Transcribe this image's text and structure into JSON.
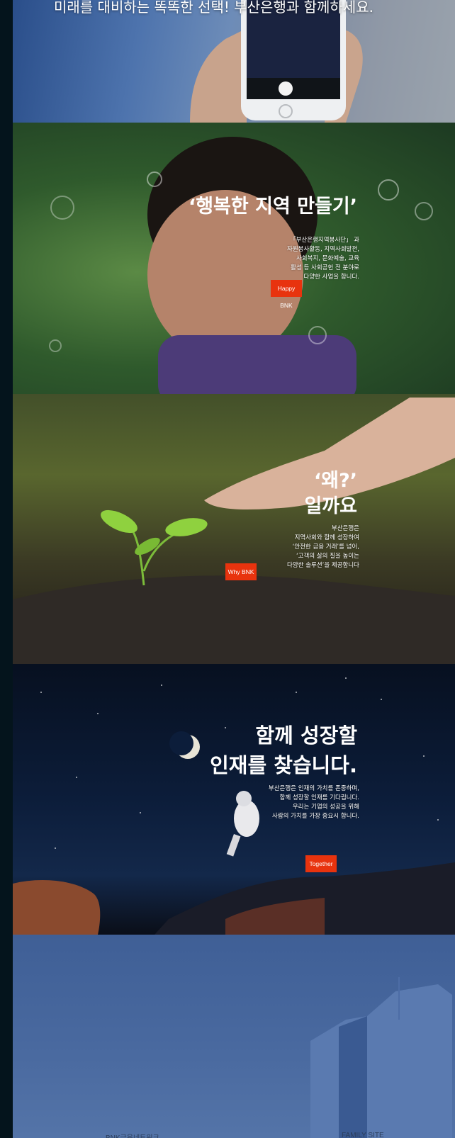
{
  "hero": {
    "caption": "미래를 대비하는 똑똑한 선택! 부산은행과 함께하세요."
  },
  "happy": {
    "title": "‘행복한 지역 만들기’",
    "body": "「부산은행지역봉사단」 과\n자원봉사활동, 지역사회발전,\n사회복지, 문화예술, 교육\n활성 등 사회공헌 전 분야로\n다양한 사업을 합니다.",
    "button": "Happy BNK"
  },
  "why": {
    "title_line1": "‘왜?’",
    "title_line2": "일까요",
    "body": "부산은행은\n지역사회와 함께 성장하여\n‘안전한 금융 거래’를 넘어,\n‘고객의 삶의 질을 높이는\n다양한 솔루션’을 제공합니다",
    "button": "Why BNK"
  },
  "together": {
    "title_line1": "함께 성장할",
    "title_line2": "인재를 찾습니다.",
    "body": "부산은행은 인재의 가치를 존중하며,\n함께 성장할 인재를 기다립니다.\n우리는 기업의 성공을 위해\n사람의 가치를 가장 중요시 합니다.",
    "button": "Together"
  },
  "footer": {
    "network_label": "BNK금융네트워크",
    "family_label": "FAMILY SITE"
  },
  "colors": {
    "accent": "#e8330e",
    "sidebar": "#04141c"
  }
}
